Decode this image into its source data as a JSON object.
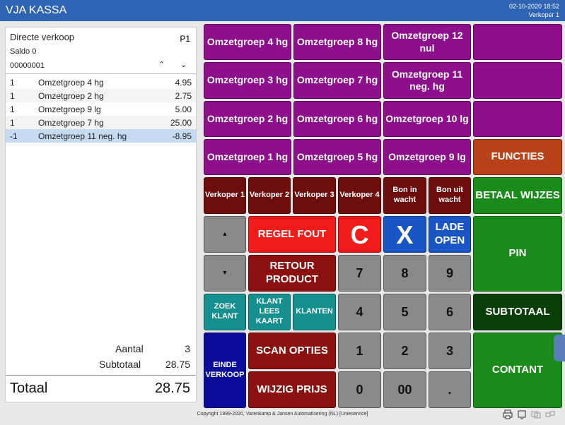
{
  "title": "VJA KASSA",
  "datetime": "02-10-2020  18:52",
  "user": "Verkoper 1",
  "sale": {
    "mode": "Directe verkoop",
    "page": "P1",
    "saldo": "Saldo 0",
    "number": "00000001",
    "rows": [
      {
        "qty": "1",
        "name": "Omzetgroep 4 hg",
        "price": "4.95"
      },
      {
        "qty": "1",
        "name": "Omzetgroep 2 hg",
        "price": "2.75"
      },
      {
        "qty": "1",
        "name": "Omzetgroep 9 lg",
        "price": "5.00"
      },
      {
        "qty": "1",
        "name": "Omzetgroep 7 hg",
        "price": "25.00"
      },
      {
        "qty": "-1",
        "name": "Omzetgroep 11 neg. hg",
        "price": "-8.95"
      }
    ],
    "aantal_label": "Aantal",
    "aantal": "3",
    "subtotaal_label": "Subtotaal",
    "subtotaal": "28.75",
    "totaal_label": "Totaal",
    "totaal": "28.75"
  },
  "groups": {
    "g4": "Omzetgroep 4 hg",
    "g8": "Omzetgroep 8 hg",
    "g12": "Omzetgroep 12 nul",
    "g3": "Omzetgroep 3 hg",
    "g7": "Omzetgroep 7 hg",
    "g11": "Omzetgroep 11 neg. hg",
    "g2": "Omzetgroep 2 hg",
    "g6": "Omzetgroep 6 hg",
    "g10": "Omzetgroep 10 lg",
    "g1": "Omzetgroep 1 hg",
    "g5": "Omzetgroep 5 hg",
    "g9": "Omzetgroep 9 lg"
  },
  "buttons": {
    "functies": "FUNCTIES",
    "verkoper1": "Verkoper 1",
    "verkoper2": "Verkoper 2",
    "verkoper3": "Verkoper 3",
    "verkoper4": "Verkoper 4",
    "bon_in": "Bon in wacht",
    "bon_uit": "Bon uit wacht",
    "betaalwijzes": "BETAAL WIJZES",
    "up": "▲",
    "down": "▼",
    "regel_fout": "REGEL FOUT",
    "c": "C",
    "x": "X",
    "lade_open": "LADE OPEN",
    "pin": "PIN",
    "retour": "RETOUR PRODUCT",
    "zoek_klant": "ZOEK KLANT",
    "klant_lees": "KLANT LEES KAART",
    "klanten": "KLANTEN",
    "subtotaal": "SUBTOTAAL",
    "einde": "EINDE VERKOOP",
    "scan": "SCAN OPTIES",
    "wijzig": "WIJZIG PRIJS",
    "contant": "CONTANT",
    "k7": "7",
    "k8": "8",
    "k9": "9",
    "k4": "4",
    "k5": "5",
    "k6": "6",
    "k1": "1",
    "k2": "2",
    "k3": "3",
    "k0": "0",
    "k00": "00",
    "kdot": "."
  },
  "footer": "Copyright 1999-2020, Varenkamp & Jansen Automatisering (NL) [Unieservice]"
}
